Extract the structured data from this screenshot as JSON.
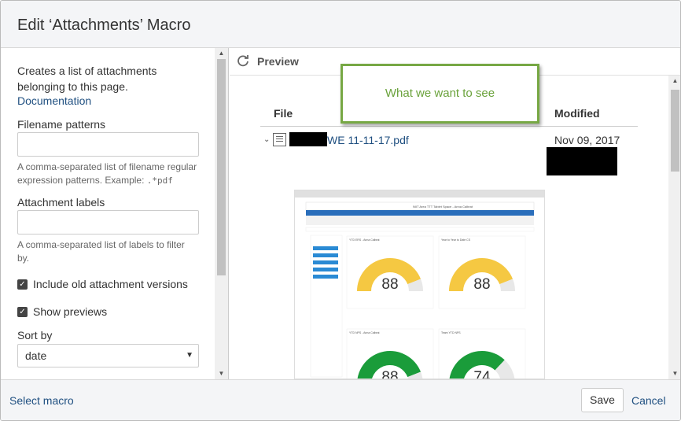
{
  "dialog": {
    "title": "Edit ‘Attachments’ Macro"
  },
  "left": {
    "description_line1": "Creates a list of attachments",
    "description_line2": "belonging to this page.",
    "documentation_link": "Documentation",
    "filename_patterns": {
      "label": "Filename patterns",
      "value": "",
      "hint_line1": "A comma-separated list of filename regular",
      "hint_line2_text": "expression patterns. Example: ",
      "hint_code": ".*pdf"
    },
    "attachment_labels": {
      "label": "Attachment labels",
      "value": "",
      "hint_line1": "A comma-separated list of labels to filter",
      "hint_line2": "by."
    },
    "include_old_versions": {
      "label": "Include old attachment versions",
      "checked": true
    },
    "show_previews": {
      "label": "Show previews",
      "checked": true
    },
    "sort_by": {
      "label": "Sort by",
      "value": "date"
    }
  },
  "preview": {
    "label": "Preview",
    "callout": "What we want to see",
    "columns": {
      "file": "File",
      "modified": "Modified"
    },
    "row": {
      "file_name": "WE 11-11-17.pdf",
      "modified": "Nov 09, 2017"
    },
    "thumbnail": {
      "header_title": "NIIT Area TTT Tablet Space - Anna Calbrat",
      "panels": [
        {
          "title": "YTD ERS - Anna Calbrat",
          "value": "88",
          "color": "#f5c842",
          "fraction": 0.88
        },
        {
          "title": "Year to Year to Date CS",
          "value": "88",
          "color": "#f5c842",
          "fraction": 0.88
        },
        {
          "title": "YTD NPS - Anna Calbrat",
          "value": "88",
          "color": "#1a9c3a",
          "fraction": 0.88
        },
        {
          "title": "Team YTD NPS",
          "value": "74",
          "color": "#1a9c3a",
          "fraction": 0.74
        }
      ]
    }
  },
  "footer": {
    "select_macro": "Select macro",
    "save": "Save",
    "cancel": "Cancel"
  },
  "colors": {
    "link": "#205081",
    "callout_border": "#77a844",
    "gauge_yellow": "#f5c842",
    "gauge_green": "#1a9c3a"
  }
}
